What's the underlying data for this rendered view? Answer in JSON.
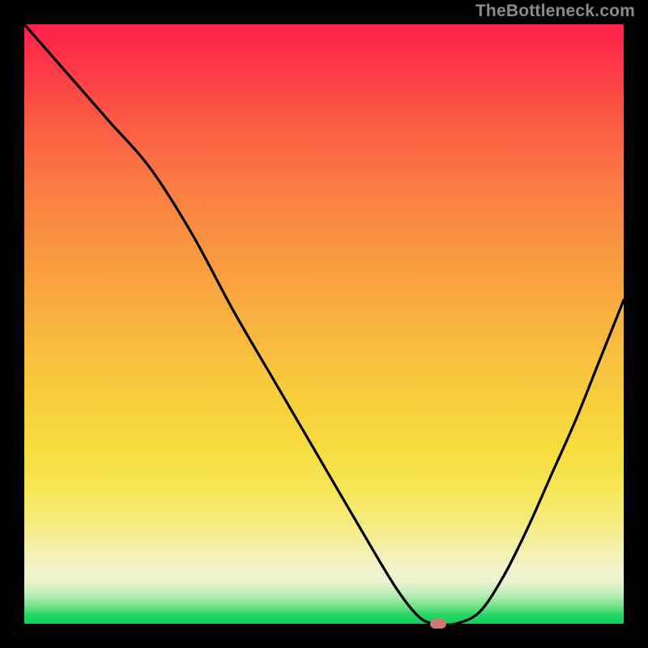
{
  "attribution": "TheBottleneck.com",
  "colors": {
    "page_bg": "#000000",
    "attribution_text": "#8a8a8a",
    "curve_stroke": "#000000",
    "marker_fill": "#d07878",
    "gradient_stops": [
      {
        "pct": 0,
        "hex": "#fe1f4b"
      },
      {
        "pct": 16,
        "hex": "#fb5a44"
      },
      {
        "pct": 38,
        "hex": "#f99740"
      },
      {
        "pct": 60,
        "hex": "#f7c93d"
      },
      {
        "pct": 85,
        "hex": "#f5ed8e"
      },
      {
        "pct": 93,
        "hex": "#e8f4cf"
      },
      {
        "pct": 97,
        "hex": "#74e38b"
      },
      {
        "pct": 100,
        "hex": "#0fd158"
      }
    ]
  },
  "chart_data": {
    "type": "line",
    "title": "",
    "xlabel": "",
    "ylabel": "",
    "xlim": [
      0,
      100
    ],
    "ylim": [
      0,
      100
    ],
    "x": [
      0,
      7,
      14,
      21,
      28,
      35,
      42,
      49,
      56,
      62,
      66,
      69,
      72,
      76,
      80,
      84,
      88,
      92,
      96,
      100
    ],
    "y": [
      100,
      92,
      84,
      76,
      65,
      52,
      40,
      28,
      16,
      6,
      1,
      0,
      0,
      2,
      8,
      16,
      25,
      34,
      44,
      54
    ],
    "marker": {
      "x": 69,
      "y": 0
    },
    "grid": false,
    "legend": false
  }
}
